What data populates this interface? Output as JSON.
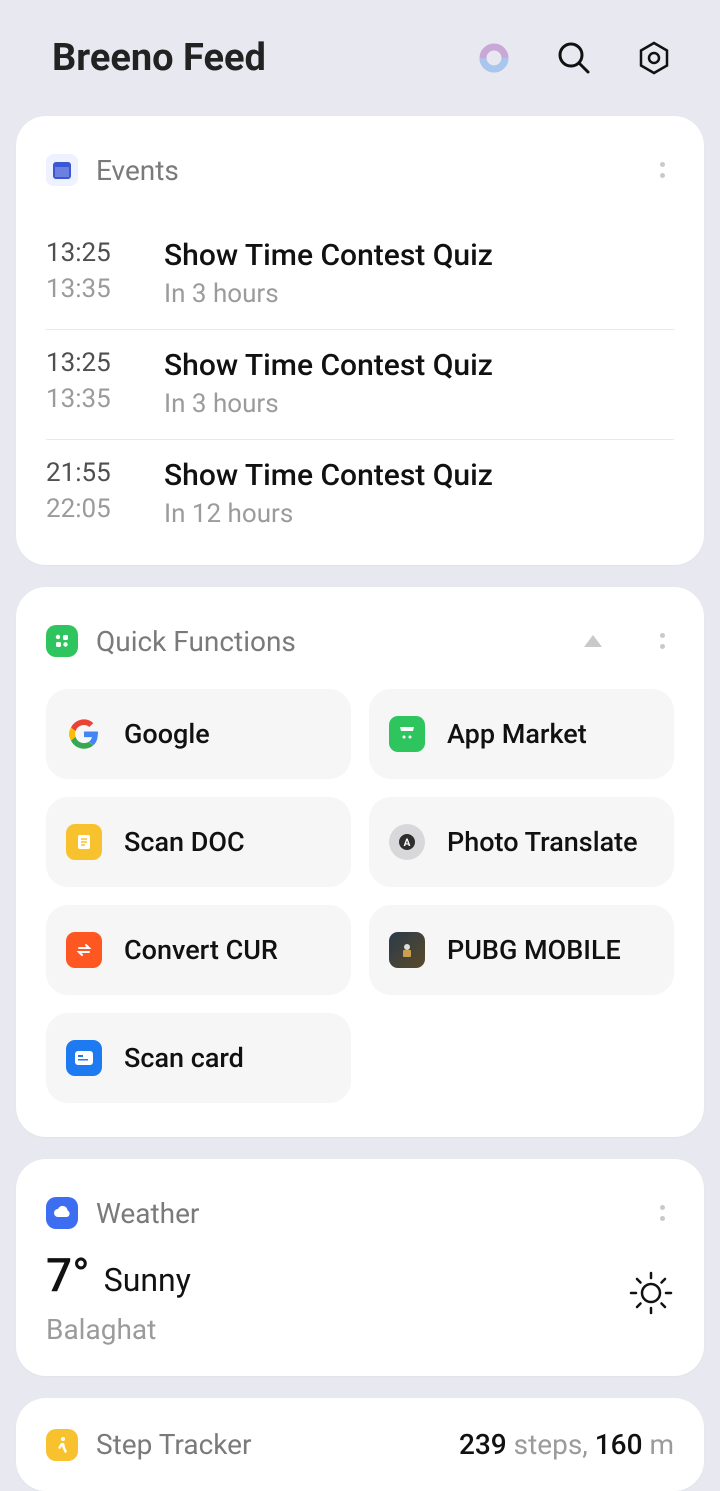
{
  "header": {
    "title": "Breeno Feed"
  },
  "events": {
    "title": "Events",
    "items": [
      {
        "start": "13:25",
        "end": "13:35",
        "title": "Show Time Contest Quiz",
        "in": "In 3 hours"
      },
      {
        "start": "13:25",
        "end": "13:35",
        "title": "Show Time Contest Quiz",
        "in": "In 3 hours"
      },
      {
        "start": "21:55",
        "end": "22:05",
        "title": "Show Time Contest Quiz",
        "in": "In 12 hours"
      }
    ]
  },
  "quick_functions": {
    "title": "Quick Functions",
    "items": [
      {
        "label": "Google",
        "icon": "google-icon"
      },
      {
        "label": "App Market",
        "icon": "app-market-icon"
      },
      {
        "label": "Scan DOC",
        "icon": "scan-doc-icon"
      },
      {
        "label": "Photo Translate",
        "icon": "photo-translate-icon"
      },
      {
        "label": "Convert CUR",
        "icon": "convert-cur-icon"
      },
      {
        "label": "PUBG MOBILE",
        "icon": "pubg-icon"
      },
      {
        "label": "Scan card",
        "icon": "scan-card-icon"
      }
    ]
  },
  "weather": {
    "title": "Weather",
    "temperature": "7°",
    "condition": "Sunny",
    "location": "Balaghat"
  },
  "step_tracker": {
    "title": "Step Tracker",
    "steps_num": "239",
    "steps_lbl": " steps, ",
    "dist_num": "160",
    "dist_lbl": " m"
  }
}
